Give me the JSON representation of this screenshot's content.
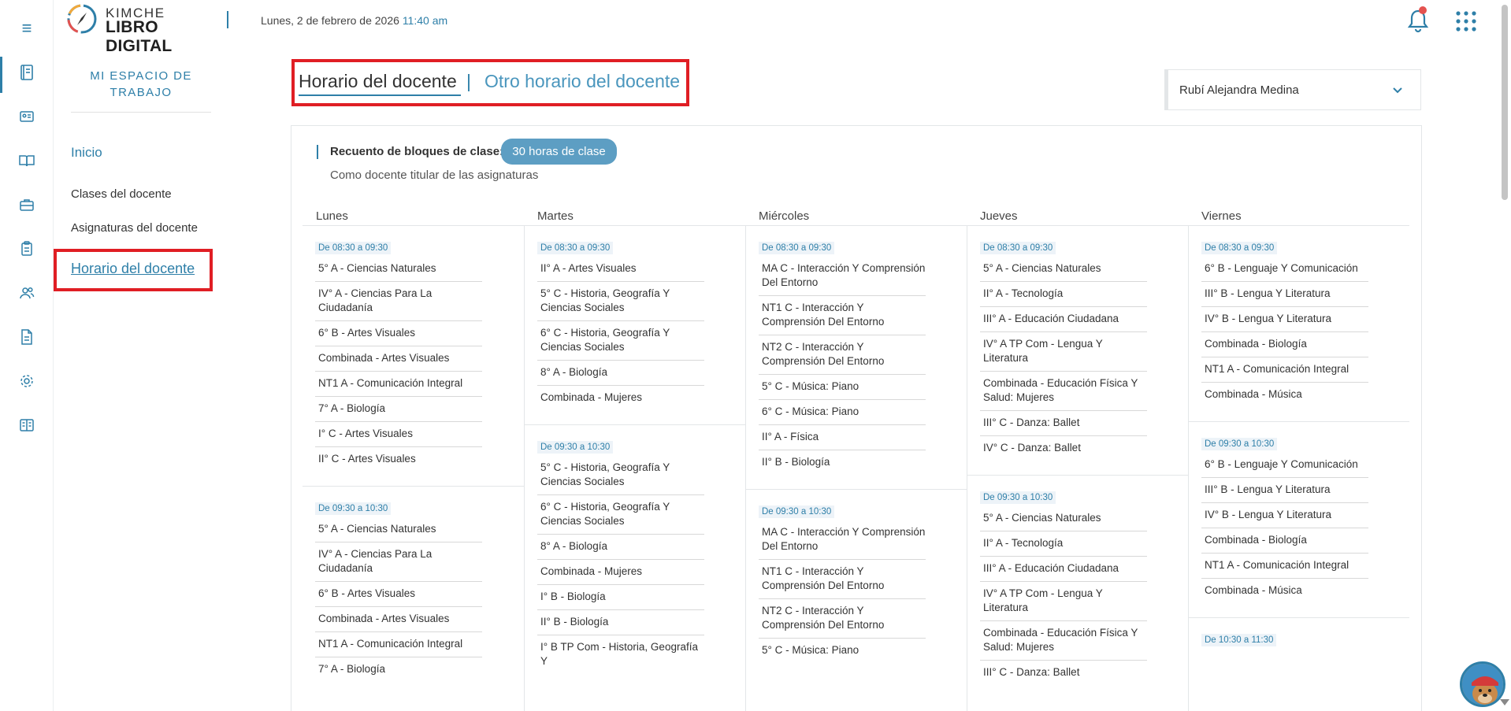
{
  "header": {
    "logo_top": "KIMCHE",
    "logo_bottom": "LIBRO DIGITAL",
    "date": "Lunes, 2 de febrero de 2026",
    "time": "11:40 am"
  },
  "sidebar": {
    "title": "MI ESPACIO DE TRABAJO",
    "inicio": "Inicio",
    "items": [
      {
        "label": "Clases del docente"
      },
      {
        "label": "Asignaturas del docente"
      },
      {
        "label": "Horario del docente"
      }
    ]
  },
  "tabs": {
    "active": "Horario del docente",
    "separator": "|",
    "other": "Otro horario del docente"
  },
  "teacher_select": {
    "value": "Rubí Alejandra Medina"
  },
  "summary": {
    "label": "Recuento de bloques de clase:",
    "hours": "30 horas de clase",
    "subtitle": "Como docente titular de las asignaturas"
  },
  "colors": {
    "accent": "#2e7fa8",
    "highlight_red": "#e01e24",
    "pill": "#5d9ec3"
  },
  "schedule": [
    {
      "day": "Lunes",
      "blocks": [
        {
          "time": "De 08:30 a 09:30",
          "classes": [
            "5° A - Ciencias Naturales",
            "IV° A - Ciencias Para La Ciudadanía",
            "6° B - Artes Visuales",
            "Combinada - Artes Visuales",
            "NT1 A - Comunicación Integral",
            "7° A - Biología",
            "I° C - Artes Visuales",
            "II° C - Artes Visuales"
          ]
        },
        {
          "time": "De 09:30 a 10:30",
          "classes": [
            "5° A - Ciencias Naturales",
            "IV° A - Ciencias Para La Ciudadanía",
            "6° B - Artes Visuales",
            "Combinada - Artes Visuales",
            "NT1 A - Comunicación Integral",
            "7° A - Biología"
          ]
        }
      ]
    },
    {
      "day": "Martes",
      "blocks": [
        {
          "time": "De 08:30 a 09:30",
          "classes": [
            "II° A - Artes Visuales",
            "5° C - Historia, Geografía Y Ciencias Sociales",
            "6° C - Historia, Geografía Y Ciencias Sociales",
            "8° A - Biología",
            "Combinada - Mujeres"
          ]
        },
        {
          "time": "De 09:30 a 10:30",
          "classes": [
            "5° C - Historia, Geografía Y Ciencias Sociales",
            "6° C - Historia, Geografía Y Ciencias Sociales",
            "8° A - Biología",
            "Combinada - Mujeres",
            "I° B - Biología",
            "II° B - Biología",
            "I° B TP Com - Historia, Geografía Y"
          ]
        }
      ]
    },
    {
      "day": "Miércoles",
      "blocks": [
        {
          "time": "De 08:30 a 09:30",
          "classes": [
            "MA C - Interacción Y Comprensión Del Entorno",
            "NT1 C - Interacción Y Comprensión Del Entorno",
            "NT2 C - Interacción Y Comprensión Del Entorno",
            "5° C - Música: Piano",
            "6° C - Música: Piano",
            "II° A - Física",
            "II° B - Biología"
          ]
        },
        {
          "time": "De 09:30 a 10:30",
          "classes": [
            "MA C - Interacción Y Comprensión Del Entorno",
            "NT1 C - Interacción Y Comprensión Del Entorno",
            "NT2 C - Interacción Y Comprensión Del Entorno",
            "5° C - Música: Piano"
          ]
        }
      ]
    },
    {
      "day": "Jueves",
      "blocks": [
        {
          "time": "De 08:30 a 09:30",
          "classes": [
            "5° A - Ciencias Naturales",
            "II° A - Tecnología",
            "III° A - Educación Ciudadana",
            "IV° A TP Com - Lengua Y Literatura",
            "Combinada - Educación Física Y Salud: Mujeres",
            "III° C - Danza: Ballet",
            "IV° C - Danza: Ballet"
          ]
        },
        {
          "time": "De 09:30 a 10:30",
          "classes": [
            "5° A - Ciencias Naturales",
            "II° A - Tecnología",
            "III° A - Educación Ciudadana",
            "IV° A TP Com - Lengua Y Literatura",
            "Combinada - Educación Física Y Salud: Mujeres",
            "III° C - Danza: Ballet"
          ]
        }
      ]
    },
    {
      "day": "Viernes",
      "blocks": [
        {
          "time": "De 08:30 a 09:30",
          "classes": [
            "6° B - Lenguaje Y Comunicación",
            "III° B - Lengua Y Literatura",
            "IV° B - Lengua Y Literatura",
            "Combinada - Biología",
            "NT1 A - Comunicación Integral",
            "Combinada - Música"
          ]
        },
        {
          "time": "De 09:30 a 10:30",
          "classes": [
            "6° B - Lenguaje Y Comunicación",
            "III° B - Lengua Y Literatura",
            "IV° B - Lengua Y Literatura",
            "Combinada - Biología",
            "NT1 A - Comunicación Integral",
            "Combinada - Música"
          ]
        },
        {
          "time": "De 10:30 a 11:30",
          "classes": []
        }
      ]
    }
  ]
}
